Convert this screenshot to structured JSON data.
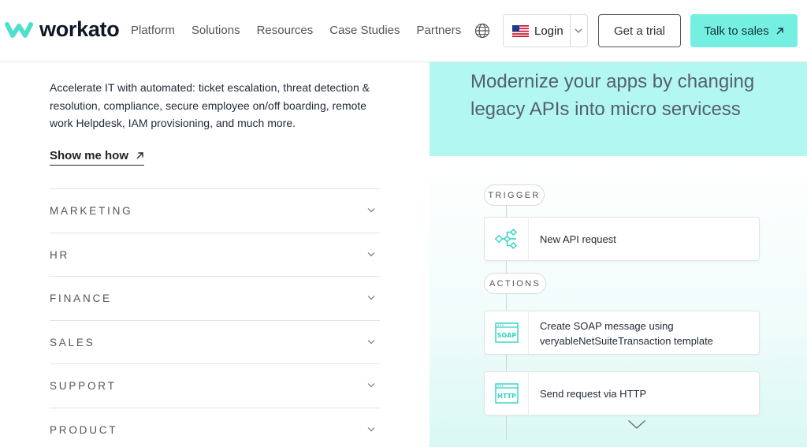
{
  "header": {
    "brand": "workato",
    "nav": [
      "Platform",
      "Solutions",
      "Resources",
      "Case Studies",
      "Partners"
    ],
    "login_label": "Login",
    "trial_label": "Get a trial",
    "sales_label": "Talk to sales"
  },
  "left": {
    "intro": "Accelerate IT with automated: ticket escalation, threat detection & resolution, compliance, secure employee on/off boarding, remote work Helpdesk, IAM provisioning, and much more.",
    "show_link": "Show me how",
    "accordion": [
      "MARKETING",
      "HR",
      "FINANCE",
      "SALES",
      "SUPPORT",
      "PRODUCT"
    ]
  },
  "panel": {
    "headline": "Modernize your apps by changing legacy APIs into micro servicess",
    "trigger_label": "TRIGGER",
    "actions_label": "ACTIONS",
    "steps": [
      {
        "icon": "flow-icon",
        "text": "New API request"
      },
      {
        "icon": "soap-icon",
        "text": "Create SOAP message using veryableNetSuiteTransaction template"
      },
      {
        "icon": "http-icon",
        "text": "Send request via HTTP"
      }
    ],
    "icon_labels": {
      "soap": "SOAP",
      "http": "HTTP"
    }
  },
  "colors": {
    "accent": "#74efe0",
    "panel_top": "#b2f7f1",
    "icon_teal": "#2fd3c3"
  }
}
